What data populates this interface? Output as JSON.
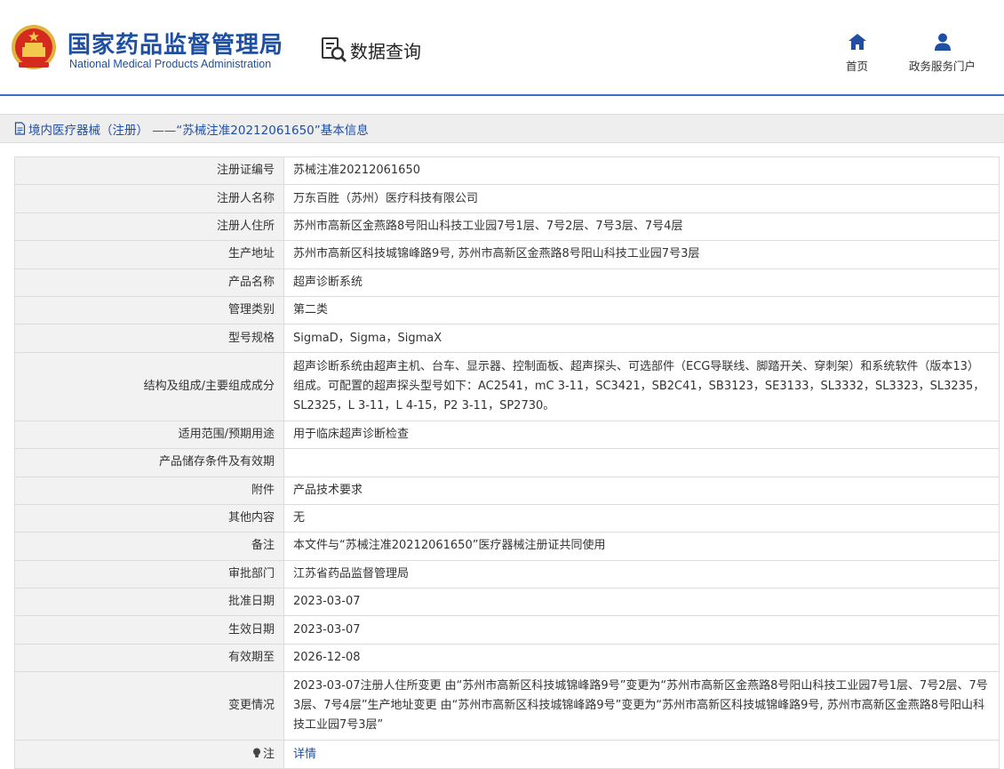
{
  "header": {
    "title_cn": "国家药品监督管理局",
    "title_en": "National Medical Products Administration",
    "query_label": "数据查询",
    "nav": [
      {
        "label": "首页",
        "icon": "home-icon"
      },
      {
        "label": "政务服务门户",
        "icon": "user-icon"
      }
    ]
  },
  "section_title": "境内医疗器械（注册） ——“苏械注准20212061650”基本信息",
  "rows": [
    {
      "label": "注册证编号",
      "value": "苏械注准20212061650"
    },
    {
      "label": "注册人名称",
      "value": "万东百胜（苏州）医疗科技有限公司"
    },
    {
      "label": "注册人住所",
      "value": "苏州市高新区金燕路8号阳山科技工业园7号1层、7号2层、7号3层、7号4层"
    },
    {
      "label": "生产地址",
      "value": "苏州市高新区科技城锦峰路9号, 苏州市高新区金燕路8号阳山科技工业园7号3层"
    },
    {
      "label": "产品名称",
      "value": "超声诊断系统"
    },
    {
      "label": "管理类别",
      "value": "第二类"
    },
    {
      "label": "型号规格",
      "value": "SigmaD，Sigma，SigmaX"
    },
    {
      "label": "结构及组成/主要组成成分",
      "value": "超声诊断系统由超声主机、台车、显示器、控制面板、超声探头、可选部件（ECG导联线、脚踏开关、穿刺架）和系统软件（版本13）组成。可配置的超声探头型号如下：AC2541，mC 3-11，SC3421，SB2C41，SB3123，SE3133，SL3332，SL3323，SL3235，SL2325，L 3-11，L 4-15，P2 3-11，SP2730。"
    },
    {
      "label": "适用范围/预期用途",
      "value": "用于临床超声诊断检查"
    },
    {
      "label": "产品储存条件及有效期",
      "value": ""
    },
    {
      "label": "附件",
      "value": "产品技术要求"
    },
    {
      "label": "其他内容",
      "value": "无"
    },
    {
      "label": "备注",
      "value": "本文件与“苏械注准20212061650”医疗器械注册证共同使用"
    },
    {
      "label": "审批部门",
      "value": "江苏省药品监督管理局"
    },
    {
      "label": "批准日期",
      "value": "2023-03-07"
    },
    {
      "label": "生效日期",
      "value": "2023-03-07"
    },
    {
      "label": "有效期至",
      "value": "2026-12-08"
    },
    {
      "label": "变更情况",
      "value": "2023-03-07注册人住所变更 由“苏州市高新区科技城锦峰路9号”变更为“苏州市高新区金燕路8号阳山科技工业园7号1层、7号2层、7号3层、7号4层”生产地址变更 由“苏州市高新区科技城锦峰路9号”变更为“苏州市高新区科技城锦峰路9号, 苏州市高新区金燕路8号阳山科技工业园7号3层”"
    }
  ],
  "note_row": {
    "label": "注",
    "link": "详情",
    "icon": "lightbulb-icon"
  },
  "colors": {
    "brand": "#1e4fa3",
    "label_bg": "#f2f2f2",
    "border": "#dcdcdc"
  }
}
